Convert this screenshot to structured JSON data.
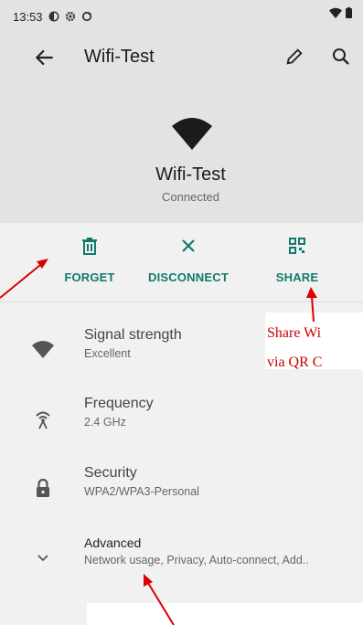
{
  "status_bar": {
    "time": "13:53",
    "icons": [
      "data-saver-icon",
      "settings-icon",
      "sync-icon"
    ],
    "right_icons": [
      "wifi-status-icon",
      "battery-icon"
    ]
  },
  "app_bar": {
    "title": "Wifi-Test",
    "back_icon": "arrow-back-icon",
    "edit_icon": "edit-pencil-icon",
    "search_icon": "search-icon"
  },
  "network": {
    "name": "Wifi-Test",
    "status": "Connected"
  },
  "actions": [
    {
      "label": "FORGET",
      "icon": "trash-icon"
    },
    {
      "label": "DISCONNECT",
      "icon": "close-icon"
    },
    {
      "label": "SHARE",
      "icon": "qr-code-icon"
    }
  ],
  "details": [
    {
      "title": "Signal strength",
      "value": "Excellent",
      "icon": "wifi-signal-icon"
    },
    {
      "title": "Frequency",
      "value": "2.4 GHz",
      "icon": "antenna-icon"
    },
    {
      "title": "Security",
      "value": "WPA2/WPA3-Personal",
      "icon": "lock-icon"
    },
    {
      "title": "Advanced",
      "value": "Network usage, Privacy, Auto-connect, Add..",
      "icon": "chevron-down-icon"
    }
  ],
  "annotations": {
    "share_note_line1": "Share Wi",
    "share_note_line2": "via QR C"
  },
  "colors": {
    "accent": "#127a6b",
    "annotation": "#cc0000",
    "header_bg": "#e3e3e3",
    "body_bg": "#f1f1f1"
  }
}
